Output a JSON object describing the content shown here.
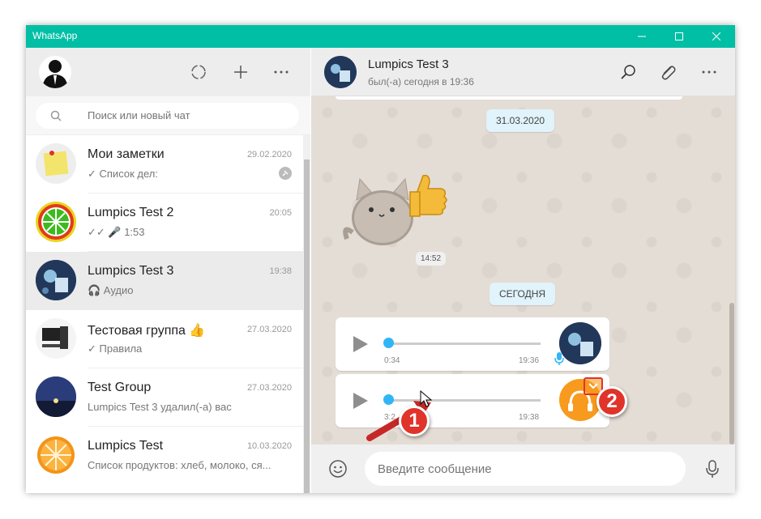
{
  "app": {
    "title": "WhatsApp"
  },
  "window_controls": {
    "minimize": "—",
    "maximize": "☐",
    "close": "✕"
  },
  "search": {
    "placeholder": "Поиск или новый чат"
  },
  "chats": [
    {
      "name": "Мои заметки",
      "time": "29.02.2020",
      "preview": "✓ Список дел:"
    },
    {
      "name": "Lumpics Test 2",
      "time": "20:05",
      "preview": "✓✓ 🎤 1:53"
    },
    {
      "name": "Lumpics Test 3",
      "time": "19:38",
      "preview": "🎧 Аудио"
    },
    {
      "name": "Тестовая группа 👍",
      "time": "27.03.2020",
      "preview": "✓ Правила"
    },
    {
      "name": "Test Group",
      "time": "27.03.2020",
      "preview": "Lumpics Test 3 удалил(-а) вас"
    },
    {
      "name": "Lumpics Test",
      "time": "10.03.2020",
      "preview": "Список продуктов: хлеб, молоко, ся..."
    }
  ],
  "conversation": {
    "name": "Lumpics Test 3",
    "status": "был(-а) сегодня в 19:36",
    "date_label": "31.03.2020",
    "sticker_time": "14:52",
    "today_label": "СЕГОДНЯ",
    "voice_messages": [
      {
        "duration": "0:34",
        "time": "19:36",
        "progress": 0
      },
      {
        "duration": "3:2",
        "time": "19:38",
        "progress": 0
      }
    ]
  },
  "composer": {
    "placeholder": "Введите сообщение"
  },
  "annotations": {
    "callout_1": "1",
    "callout_2": "2"
  },
  "colors": {
    "accent": "#00bfa5",
    "bubble_system": "#e1f3fb",
    "chat_bg": "#e4ddd5",
    "audio_orange": "#f79a1e",
    "callout_red": "#e0332a"
  }
}
